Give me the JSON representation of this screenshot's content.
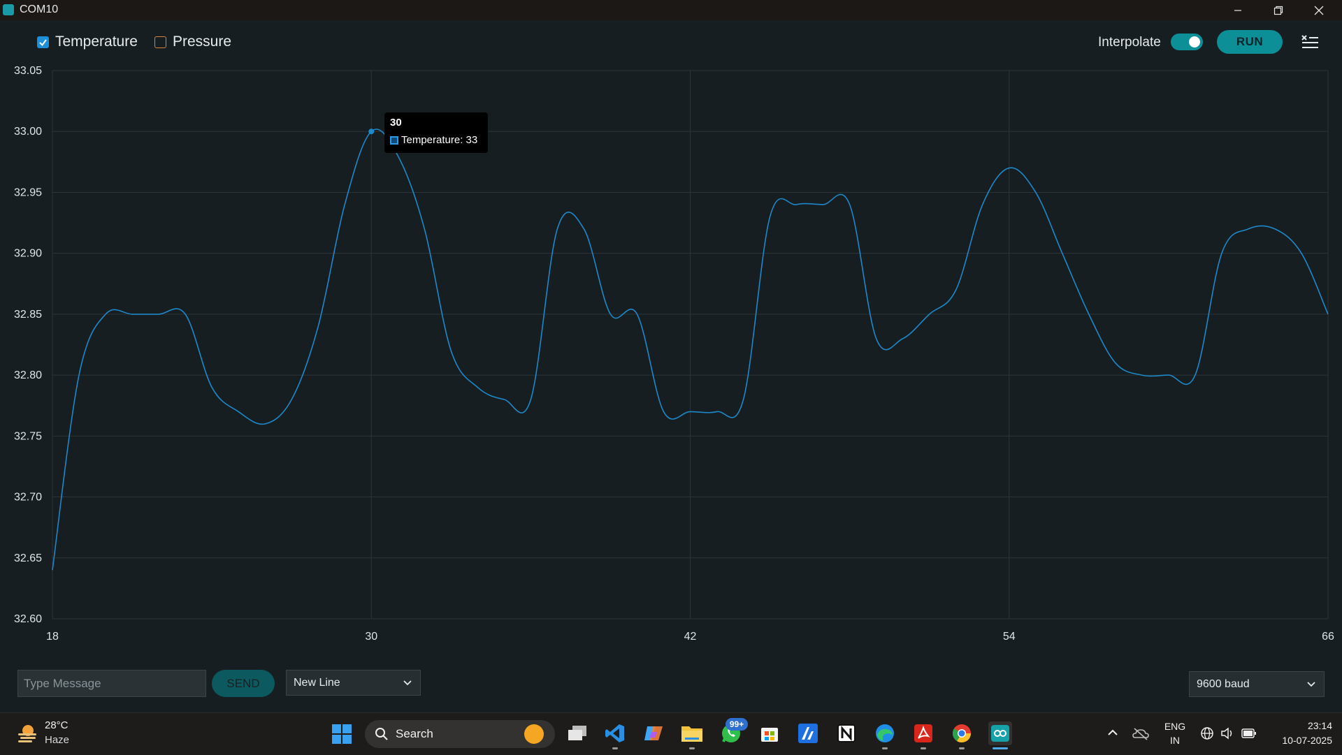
{
  "window": {
    "title": "COM10",
    "controls": [
      "minimize-icon",
      "restore-icon",
      "close-icon"
    ]
  },
  "toolbar": {
    "series": [
      {
        "label": "Temperature",
        "checked": true,
        "color": "#1d8fd8"
      },
      {
        "label": "Pressure",
        "checked": false,
        "color": "#d8823a"
      }
    ],
    "interpolate_label": "Interpolate",
    "interpolate_on": true,
    "run_label": "RUN",
    "accent": "#0d8f98"
  },
  "tooltip": {
    "title": "30",
    "text": "Temperature: 33"
  },
  "chart_data": {
    "type": "line",
    "title": "",
    "xlabel": "",
    "ylabel": "",
    "xlim": [
      18,
      66
    ],
    "ylim": [
      32.6,
      33.05
    ],
    "x_ticks": [
      "18",
      "30",
      "42",
      "54",
      "66"
    ],
    "y_ticks": [
      "33.05",
      "33.00",
      "32.95",
      "32.90",
      "32.85",
      "32.80",
      "32.75",
      "32.70",
      "32.65",
      "32.60"
    ],
    "grid": true,
    "series": [
      {
        "name": "Temperature",
        "color": "#1e88c8",
        "x": [
          18,
          19,
          20,
          21,
          22,
          23,
          24,
          25,
          26,
          27,
          28,
          29,
          30,
          31,
          32,
          33,
          34,
          35,
          36,
          37,
          38,
          39,
          40,
          41,
          42,
          43,
          44,
          45,
          46,
          47,
          48,
          49,
          50,
          51,
          52,
          53,
          54,
          55,
          56,
          57,
          58,
          59,
          60,
          61,
          62,
          63,
          64,
          65,
          66
        ],
        "y": [
          32.64,
          32.8,
          32.85,
          32.85,
          32.85,
          32.85,
          32.79,
          32.77,
          32.76,
          32.78,
          32.84,
          32.94,
          33.0,
          32.98,
          32.92,
          32.82,
          32.79,
          32.78,
          32.78,
          32.92,
          32.92,
          32.85,
          32.85,
          32.77,
          32.77,
          32.77,
          32.78,
          32.93,
          32.94,
          32.94,
          32.94,
          32.83,
          32.83,
          32.85,
          32.87,
          32.94,
          32.97,
          32.95,
          32.9,
          32.85,
          32.81,
          32.8,
          32.8,
          32.8,
          32.9,
          32.92,
          32.92,
          32.9,
          32.85
        ]
      }
    ],
    "highlight": {
      "x": 30,
      "y": 33.0
    }
  },
  "bottom": {
    "message_placeholder": "Type Message",
    "send_label": "SEND",
    "line_ending": "New Line",
    "baud": "9600 baud"
  },
  "taskbar": {
    "weather_temp": "28°C",
    "weather_desc": "Haze",
    "search_label": "Search",
    "whatsapp_badge": "99+",
    "lang_top": "ENG",
    "lang_bottom": "IN",
    "time": "23:14",
    "date": "10-07-2025"
  }
}
